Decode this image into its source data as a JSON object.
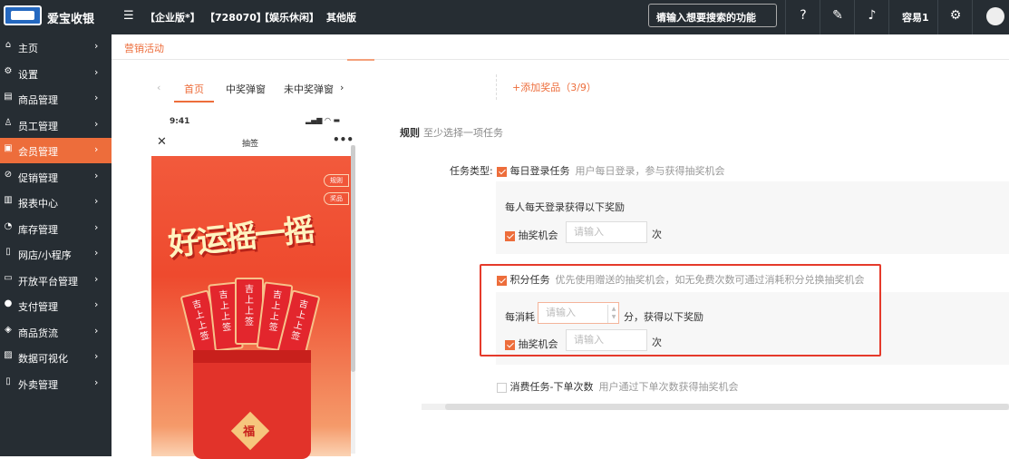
{
  "topbar": {
    "brand": "爱宝收银",
    "crumbs": [
      "【企业版*】",
      "【728070】",
      "【娱乐休闲】",
      "其他版"
    ],
    "search_placeholder": "请输入想要搜索的功能",
    "user": "容易1"
  },
  "sidebar": {
    "items": [
      {
        "label": "主页",
        "icon": "home-icon",
        "glyph": "⌂"
      },
      {
        "label": "设置",
        "icon": "settings-icon",
        "glyph": "⚙"
      },
      {
        "label": "商品管理",
        "icon": "product-icon",
        "glyph": "▤"
      },
      {
        "label": "员工管理",
        "icon": "staff-icon",
        "glyph": "♙"
      },
      {
        "label": "会员管理",
        "icon": "member-icon",
        "glyph": "▣",
        "active": true
      },
      {
        "label": "促销管理",
        "icon": "promotion-icon",
        "glyph": "⊘"
      },
      {
        "label": "报表中心",
        "icon": "report-icon",
        "glyph": "▥"
      },
      {
        "label": "库存管理",
        "icon": "inventory-icon",
        "glyph": "◔"
      },
      {
        "label": "网店/小程序",
        "icon": "store-icon",
        "glyph": "▯"
      },
      {
        "label": "开放平台管理",
        "icon": "platform-icon",
        "glyph": "▭"
      },
      {
        "label": "支付管理",
        "icon": "payment-icon",
        "glyph": "●"
      },
      {
        "label": "商品货流",
        "icon": "goods-flow-icon",
        "glyph": "◈"
      },
      {
        "label": "数据可视化",
        "icon": "data-viz-icon",
        "glyph": "▨"
      },
      {
        "label": "外卖管理",
        "icon": "takeout-icon",
        "glyph": "▯"
      }
    ],
    "arrow": "›"
  },
  "content": {
    "tab": "营销活动",
    "preview_tabs": [
      "首页",
      "中奖弹窗",
      "未中奖弹窗"
    ],
    "phone": {
      "time": "9:41",
      "title": "抽签",
      "poster_title": "好运摇一摇",
      "side_buttons": [
        "规则",
        "奖品"
      ],
      "slip_text": [
        "吉上上签",
        "吉上上签",
        "吉上上签",
        "吉上上签",
        "吉上上签"
      ],
      "fu": "福"
    },
    "add_prize": "+添加奖品（3/9）",
    "rules_label": "规则",
    "rules_hint": "至少选择一项任务",
    "task_type_label": "任务类型:",
    "tasks": {
      "daily": {
        "label": "每日登录任务",
        "desc": "用户每日登录，参与获得抽奖机会",
        "sub_hint": "每人每天登录获得以下奖励",
        "reward_label": "抽奖机会",
        "placeholder": "请输入",
        "unit": "次"
      },
      "points": {
        "label": "积分任务",
        "desc": "优先使用赠送的抽奖机会，如无免费次数可通过消耗积分兑换抽奖机会",
        "consume_prefix": "每消耗",
        "consume_placeholder": "请输入",
        "consume_suffix": "分，获得以下奖励",
        "reward_label": "抽奖机会",
        "placeholder": "请输入",
        "unit": "次"
      },
      "order": {
        "label": "消费任务-下单次数",
        "desc": "用户通过下单次数获得抽奖机会"
      }
    }
  }
}
